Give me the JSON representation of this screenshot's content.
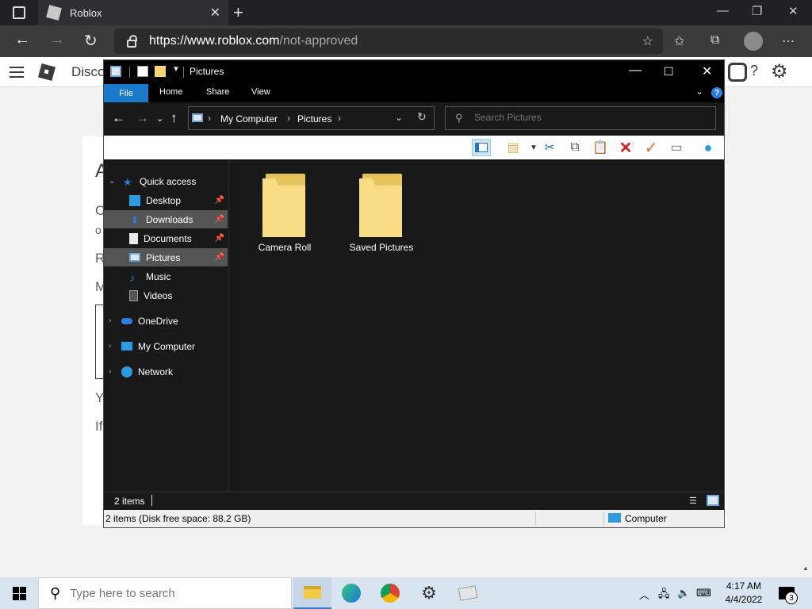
{
  "browser": {
    "tab_title": "Roblox",
    "tab_close": "✕",
    "new_tab": "+",
    "url_main": "https://www.roblox.com",
    "url_rest": "/not-approved"
  },
  "roblox": {
    "nav_title": "Disco",
    "help": "?",
    "letters": [
      "A",
      "C",
      "o",
      "R",
      "M",
      "Y",
      "If"
    ]
  },
  "explorer": {
    "title": "Pictures",
    "ribbon_tabs": [
      "File",
      "Home",
      "Share",
      "View"
    ],
    "help": "?",
    "breadcrumb": [
      "My Computer",
      "Pictures"
    ],
    "search_placeholder": "Search Pictures",
    "nav": [
      {
        "label": "Quick access",
        "pinned": false
      },
      {
        "label": "Desktop",
        "pinned": true
      },
      {
        "label": "Downloads",
        "pinned": true
      },
      {
        "label": "Documents",
        "pinned": true
      },
      {
        "label": "Pictures",
        "pinned": true
      },
      {
        "label": "Music",
        "pinned": false
      },
      {
        "label": "Videos",
        "pinned": false
      },
      {
        "label": "OneDrive",
        "pinned": false
      },
      {
        "label": "My Computer",
        "pinned": false
      },
      {
        "label": "Network",
        "pinned": false
      }
    ],
    "items": [
      "Camera Roll",
      "Saved Pictures"
    ],
    "status_count": "2 items",
    "status_detail": "2 items (Disk free space: 88.2 GB)",
    "status_location": "Computer"
  },
  "taskbar": {
    "search_placeholder": "Type here to search",
    "time": "4:17 AM",
    "date": "4/4/2022",
    "notifications": "3"
  }
}
